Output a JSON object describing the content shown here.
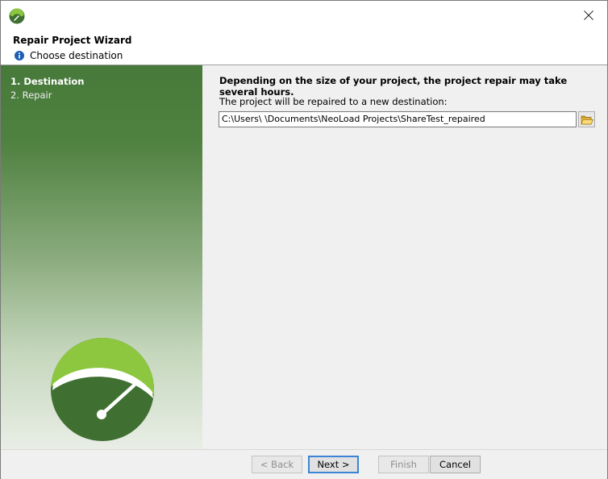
{
  "wizard": {
    "title": "Repair Project Wizard",
    "current_step_subtitle": "Choose destination"
  },
  "steps": [
    {
      "label": "1. Destination",
      "active": true
    },
    {
      "label": "2. Repair",
      "active": false
    }
  ],
  "content": {
    "heading": "Depending on the size of your project, the project repair may take several hours.",
    "destination_label": "The project will be repaired to a new destination:",
    "destination_path": "C:\\Users\\        \\Documents\\NeoLoad Projects\\ShareTest_repaired"
  },
  "buttons": {
    "back": "< Back",
    "next": "Next >",
    "finish": "Finish",
    "cancel": "Cancel"
  },
  "colors": {
    "panel_green_dark": "#47793a",
    "logo_lime": "#8dc63f",
    "logo_green": "#3f6f31",
    "default_button_border": "#3b84d6"
  },
  "icons": {
    "app": "neoload-app-icon",
    "close": "close-icon",
    "info": "info-icon",
    "browse": "folder-open-icon",
    "logo": "speedometer-logo"
  }
}
